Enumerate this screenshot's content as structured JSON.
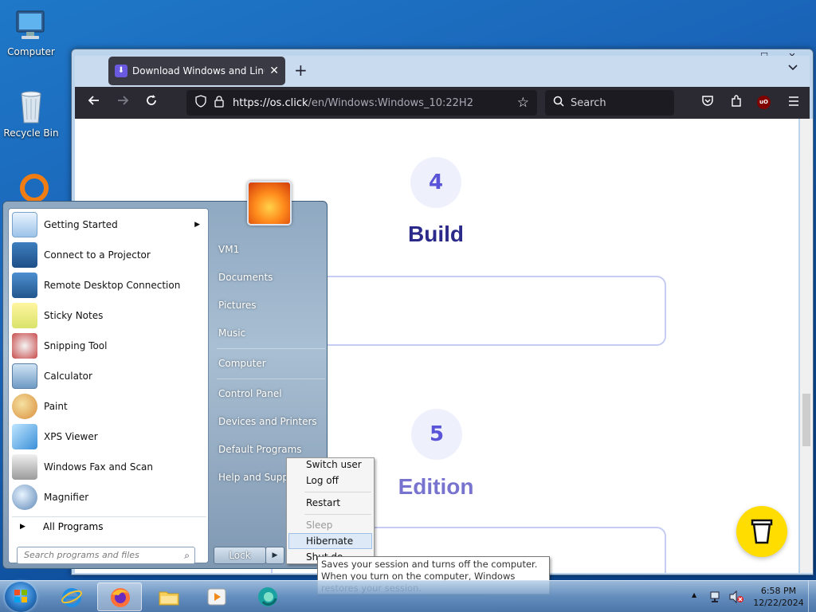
{
  "desktop": {
    "icons": [
      {
        "label": "Computer",
        "icon": "computer-icon"
      },
      {
        "label": "Recycle Bin",
        "icon": "recycle-bin-icon"
      }
    ]
  },
  "browser": {
    "window_controls": {
      "minimize": "—",
      "maximize": "☐",
      "close": "✕"
    },
    "tab": {
      "title": "Download Windows and Linux I",
      "close": "✕"
    },
    "new_tab": "+",
    "list_tabs": "⌄",
    "url": {
      "domain": "https://os.click",
      "path": "/en/Windows:Windows_10:22H2"
    },
    "search_placeholder": "Search",
    "ublock_label": "uO",
    "page": {
      "step4": {
        "number": "4",
        "title": "Build"
      },
      "step5": {
        "number": "5",
        "title": "Edition"
      }
    }
  },
  "start_menu": {
    "programs": [
      {
        "label": "Getting Started",
        "icon": "getting-started-icon",
        "submenu": true
      },
      {
        "label": "Connect to a Projector",
        "icon": "projector-icon"
      },
      {
        "label": "Remote Desktop Connection",
        "icon": "remote-desktop-icon"
      },
      {
        "label": "Sticky Notes",
        "icon": "sticky-notes-icon"
      },
      {
        "label": "Snipping Tool",
        "icon": "snipping-tool-icon"
      },
      {
        "label": "Calculator",
        "icon": "calculator-icon"
      },
      {
        "label": "Paint",
        "icon": "paint-icon"
      },
      {
        "label": "XPS Viewer",
        "icon": "xps-viewer-icon"
      },
      {
        "label": "Windows Fax and Scan",
        "icon": "fax-scan-icon"
      },
      {
        "label": "Magnifier",
        "icon": "magnifier-icon"
      }
    ],
    "all_programs": "All Programs",
    "search_placeholder": "Search programs and files",
    "right_items": [
      "VM1",
      "Documents",
      "Pictures",
      "Music",
      "Computer",
      "Control Panel",
      "Devices and Printers",
      "Default Programs",
      "Help and Support"
    ],
    "lock_label": "Lock"
  },
  "shutdown_menu": {
    "items": [
      "Switch user",
      "Log off",
      "Restart",
      "Sleep",
      "Hibernate",
      "Shut down"
    ],
    "visible_labels": {
      "switch": "Switch user",
      "logoff": "Log off",
      "restart": "Restart",
      "sleep": "Sleep",
      "hibernate": "Hibernate",
      "shutdown": "Shut do"
    },
    "highlighted": "Hibernate",
    "disabled": "Sleep"
  },
  "tooltip": "Saves your session and turns off the computer. When you turn on the computer, Windows restores your session.",
  "taskbar": {
    "items": [
      "internet-explorer-icon",
      "firefox-icon",
      "file-explorer-icon",
      "media-player-icon",
      "browser-icon"
    ],
    "active": "firefox-icon",
    "time": "6:58 PM",
    "date": "12/22/2024",
    "tray_arrow": "▲"
  }
}
